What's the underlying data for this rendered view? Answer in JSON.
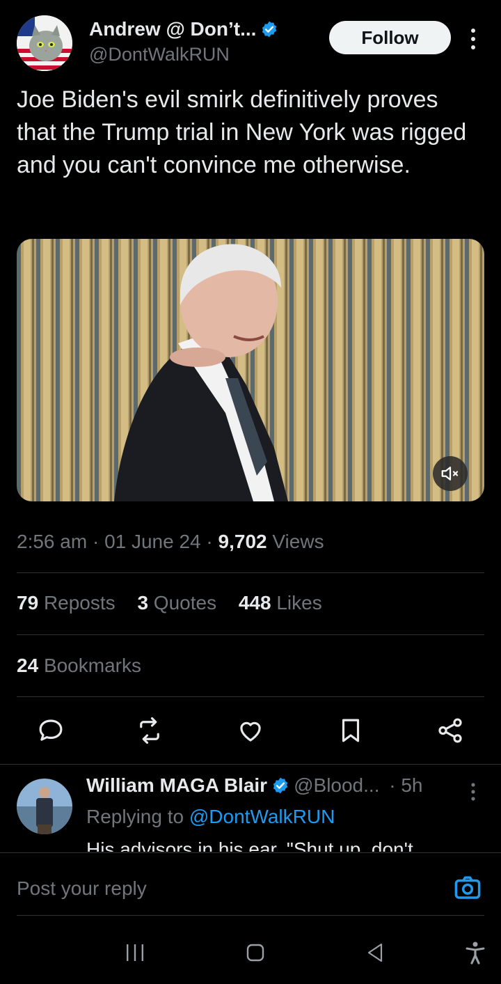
{
  "author": {
    "name": "Andrew @ Don’t...",
    "handle": "@DontWalkRUN",
    "verified": true,
    "avatar_icon": "cat-flag-avatar"
  },
  "follow_label": "Follow",
  "tweet": {
    "text": "Joe Biden's evil smirk definitively proves that the Trump trial in New York was rigged and you can't convince me otherwise.",
    "media_icon": "video-thumbnail",
    "mute_icon": "speaker-muted-icon"
  },
  "meta": {
    "time": "2:56 am",
    "date": "01 June 24",
    "views_count": "9,702",
    "views_label": "Views",
    "sep": " · "
  },
  "stats": {
    "reposts_count": "79",
    "reposts_label": "Reposts",
    "quotes_count": "3",
    "quotes_label": "Quotes",
    "likes_count": "448",
    "likes_label": "Likes",
    "bookmarks_count": "24",
    "bookmarks_label": "Bookmarks"
  },
  "actions": [
    "reply-icon",
    "repost-icon",
    "like-icon",
    "bookmark-icon",
    "share-icon"
  ],
  "reply": {
    "name": "William MAGA Blair",
    "handle": "@Blood...",
    "time": "· 5h",
    "replying_prefix": "Replying to",
    "replying_handle": "@DontWalkRUN",
    "text": "His advisors in his ear, \"Shut up, don't"
  },
  "composer": {
    "placeholder": "Post your reply"
  },
  "colors": {
    "background": "#000000",
    "accent": "#1d9bf0",
    "text_primary": "#e7e9ea",
    "text_secondary": "#71767b"
  }
}
